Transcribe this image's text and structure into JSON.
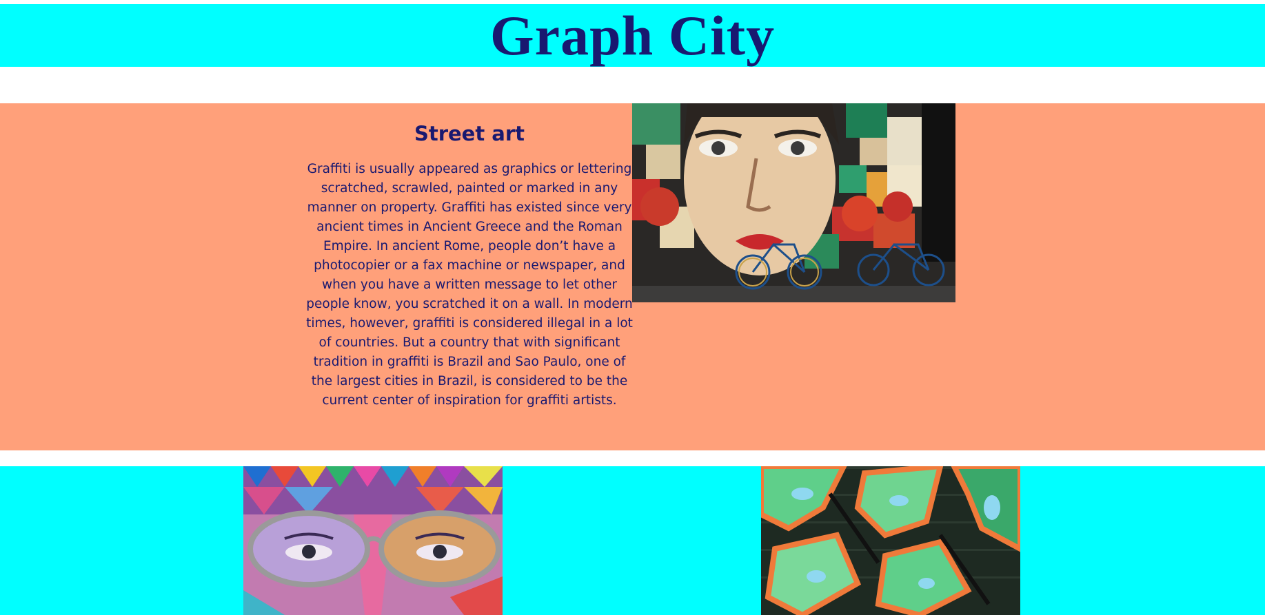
{
  "header": {
    "title": "Graph City"
  },
  "feature": {
    "heading": "Street art",
    "body": "Graffiti is usually appeared as graphics or lettering scratched, scrawled, painted or marked in any manner on property. Graffiti has existed since very ancient times in Ancient Greece and the Roman Empire. In ancient Rome, people don’t have a photocopier or a fax machine or newspaper, and when you have a written message to let other people know, you scratched it on a wall. In modern times, however, graffiti is considered illegal in a lot of countries. But a country that with significant tradition in graffiti is Brazil and Sao Paulo, one of the largest cities in Brazil, is considered to be the current center of inspiration for graffiti artists.",
    "image_subject": "street mural of a woman's face with bicycles in front"
  },
  "gallery": {
    "images": [
      {
        "subject": "colorful mural of a face with glasses"
      },
      {
        "subject": "green and orange graffiti lettering on brick wall"
      }
    ]
  },
  "colors": {
    "header_bg": "#00ffff",
    "title_text": "#191970",
    "feature_bg": "#ffa07a",
    "gallery_bg": "#00ffff"
  }
}
